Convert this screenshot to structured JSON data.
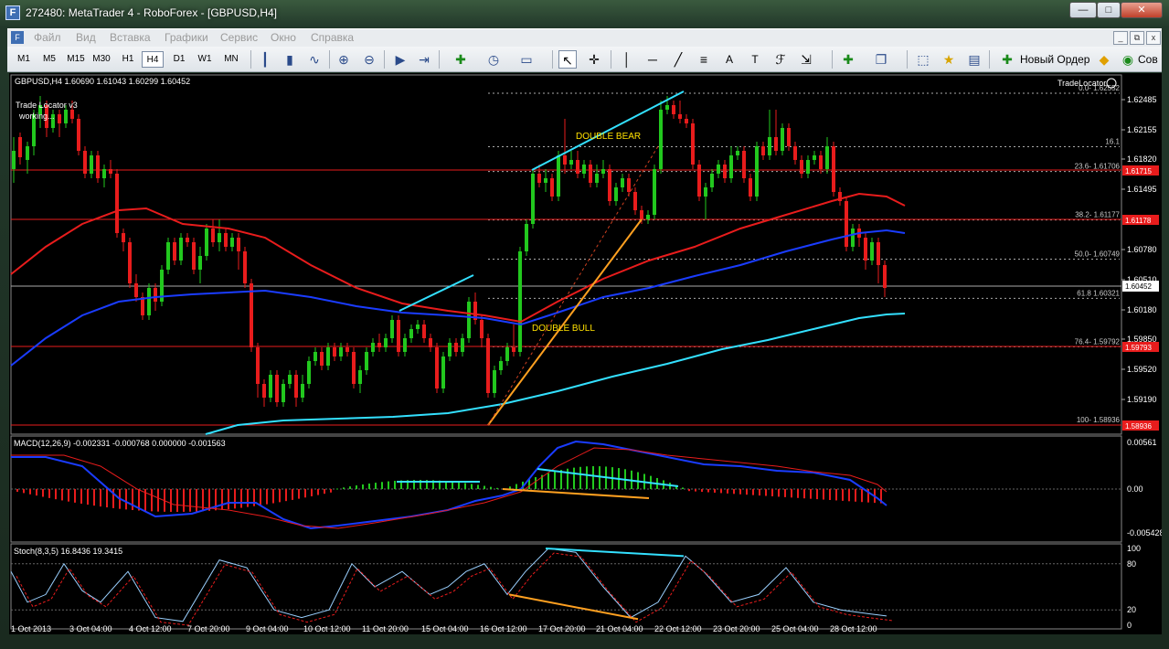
{
  "window": {
    "title": "272480: MetaTrader 4 - RoboForex - [GBPUSD,H4]",
    "icon_letter": "F",
    "min_glyph": "—",
    "max_glyph": "□",
    "close_glyph": "✕"
  },
  "menu": {
    "items": [
      "Файл",
      "Вид",
      "Вставка",
      "Графики",
      "Сервис",
      "Окно",
      "Справка"
    ]
  },
  "mdi": {
    "min": "_",
    "restore": "⧉",
    "close": "x"
  },
  "toolbar": {
    "timeframes": [
      "M1",
      "M5",
      "M15",
      "M30",
      "H1",
      "H4",
      "D1",
      "W1",
      "MN"
    ],
    "active_timeframe": "H4",
    "new_order_label": "Новый Ордер",
    "cov_label": "Сов"
  },
  "chart": {
    "info_line": "GBPUSD,H4  1.60690 1.61043 1.60299 1.60452",
    "indicator_name": "Trade Locator v3",
    "indicator_status": "working...",
    "tradelocator_label": "TradeLocator",
    "double_bear": "DOUBLE  BEAR",
    "double_bull": "DOUBLE  BULL",
    "price_labels": [
      "1.62485",
      "1.62155",
      "1.61820",
      "1.61495",
      "1.60780",
      "1.60510",
      "1.60180",
      "1.59850",
      "1.59520",
      "1.59190"
    ],
    "current_price": "1.60452",
    "fib_levels": [
      {
        "label": "0.0- 1.62552",
        "y_pct": 0
      },
      {
        "label": "16.1",
        "y_pct": 16.1
      },
      {
        "label": "23.6- 1.61706",
        "y_pct": 23.6
      },
      {
        "label": "38.2- 1.61177",
        "y_pct": 38.2
      },
      {
        "label": "50.0- 1.60749",
        "y_pct": 50
      },
      {
        "label": "61.8 1.60321",
        "y_pct": 61.8
      },
      {
        "label": "76.4- 1.59792",
        "y_pct": 76.4
      },
      {
        "label": "100- 1.58936",
        "y_pct": 100
      }
    ],
    "red_levels": [
      "1.61715",
      "1.61178",
      "1.59793",
      "1.58936"
    ]
  },
  "macd": {
    "label": "MACD(12,26,9) -0.002331 -0.000768 0.000000 -0.001563",
    "axis": [
      "0.00561",
      "0.00",
      "-0.005428"
    ]
  },
  "stoch": {
    "label": "Stoch(8,3,5) 16.8436 19.3415",
    "axis": [
      "100",
      "80",
      "20",
      "0"
    ]
  },
  "time_axis": [
    "1 Oct 2013",
    "3 Oct 04:00",
    "4 Oct 12:00",
    "7 Oct 20:00",
    "9 Oct 04:00",
    "10 Oct 12:00",
    "11 Oct 20:00",
    "15 Oct 04:00",
    "16 Oct 12:00",
    "17 Oct 20:00",
    "21 Oct 04:00",
    "22 Oct 12:00",
    "23 Oct 20:00",
    "25 Oct 04:00",
    "28 Oct 12:00"
  ],
  "colors": {
    "bull": "#22c81e",
    "bear": "#e81c1c",
    "ma_red": "#e81c1c",
    "ma_blue": "#1a3cff",
    "ma_cyan": "#33e0ff",
    "trend_orange": "#ffa020"
  }
}
